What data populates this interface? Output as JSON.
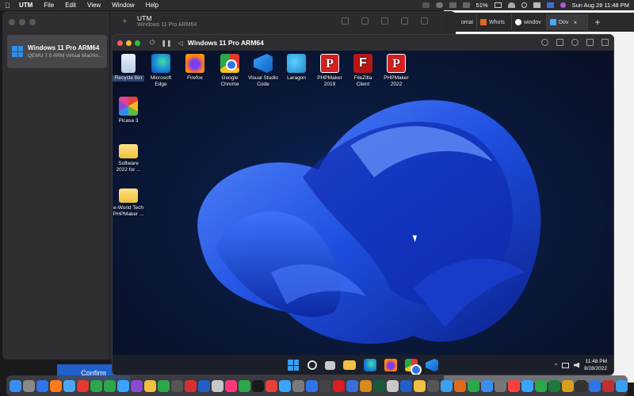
{
  "menubar": {
    "app_name": "UTM",
    "menus": [
      "File",
      "Edit",
      "View",
      "Window",
      "Help"
    ],
    "battery": "51%",
    "datetime": "Sun Aug 28  11:48 PM"
  },
  "browser": {
    "tabs": [
      {
        "label": "omai",
        "color": "#3a3a3e"
      },
      {
        "label": "WhoIs",
        "color": "#e06a1a"
      },
      {
        "label": "windov",
        "color": "#4a8af0"
      },
      {
        "label": "Dov",
        "color": "#4aa8f0",
        "active": true
      }
    ],
    "close_glyph": "×",
    "new_tab_glyph": "+"
  },
  "utm": {
    "title": "UTM",
    "subtitle": "Windows 11 Pro ARM64",
    "vm_name": "Windows 11 Pro ARM64",
    "vm_desc": "QEMU 7.0 ARM Virtual Machin...",
    "add_glyph": "+",
    "confirm_label": "Confirm"
  },
  "viewer": {
    "title": "Windows 11 Pro ARM64",
    "desktop_icons": [
      {
        "id": "recycle-bin",
        "label": "Recycle Bin",
        "kind": "recycle"
      },
      {
        "id": "microsoft-edge",
        "label": "Microsoft Edge",
        "kind": "edge"
      },
      {
        "id": "firefox",
        "label": "Firefox",
        "kind": "ff"
      },
      {
        "id": "google-chrome",
        "label": "Google Chrome",
        "kind": "chrome"
      },
      {
        "id": "visual-studio-code",
        "label": "Visual Studio Code",
        "kind": "vs"
      },
      {
        "id": "laragon",
        "label": "Laragon",
        "kind": "laragon"
      },
      {
        "id": "phpmaker-2019",
        "label": "PHPMaker 2019",
        "kind": "php",
        "glyph": "P"
      },
      {
        "id": "filezilla-client",
        "label": "FileZilla Client",
        "kind": "fz",
        "glyph": "F"
      },
      {
        "id": "phpmaker-2022",
        "label": "PHPMaker 2022",
        "kind": "php",
        "glyph": "P"
      },
      {
        "id": "picasa-3",
        "label": "Picasa 3",
        "kind": "picasa"
      },
      {
        "id": "software-folder",
        "label": "Software 2022 for ...",
        "kind": "folder"
      },
      {
        "id": "eworld-folder",
        "label": "e-World Tech PHPMaker ...",
        "kind": "folder"
      }
    ],
    "taskbar": {
      "time": "11:48 PM",
      "date": "8/28/2022",
      "tray_caret": "^"
    }
  },
  "colors": {
    "accent": "#2060c8",
    "bloom_dark": "#0b2ea8",
    "bloom_light": "#3b6cff"
  }
}
